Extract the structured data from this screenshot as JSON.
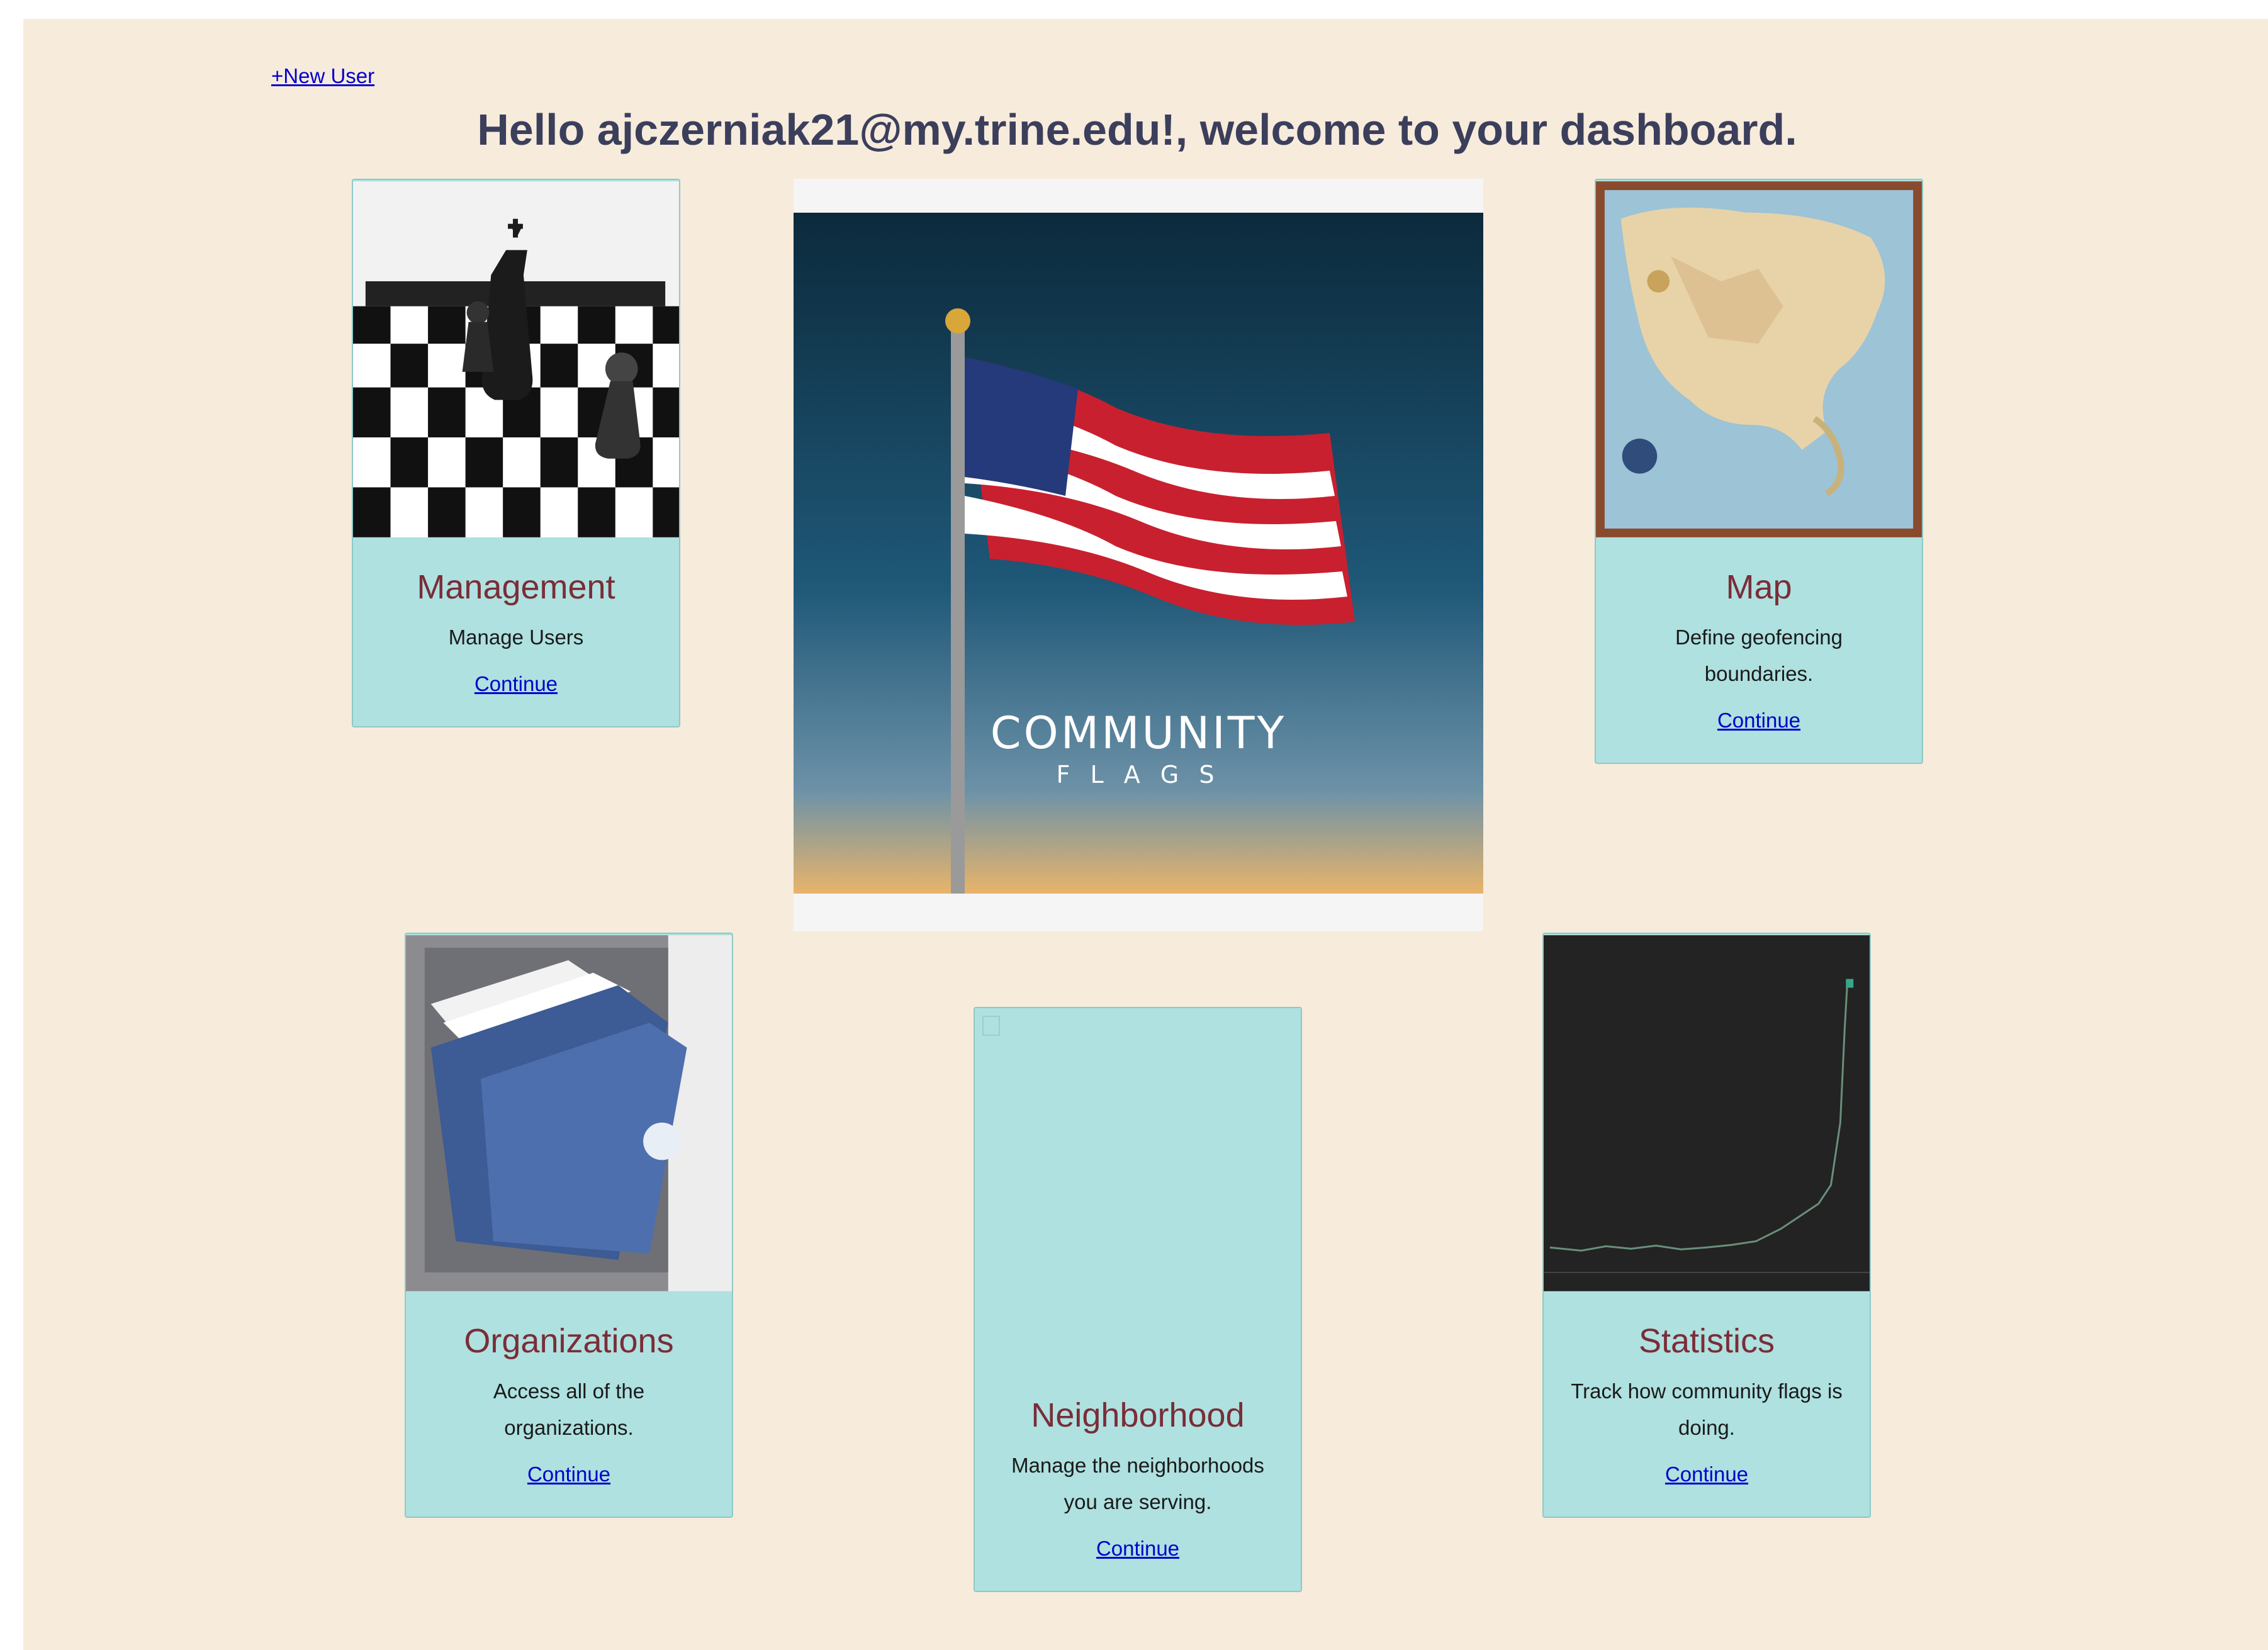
{
  "header": {
    "new_user_link": "+New User",
    "greeting": "Hello ajczerniak21@my.trine.edu!, welcome to your dashboard."
  },
  "logo": {
    "line1": "COMMUNITY",
    "line2": "F L A G S"
  },
  "cards": {
    "management": {
      "title": "Management",
      "desc": "Manage Users",
      "link": "Continue"
    },
    "map": {
      "title": "Map",
      "desc": "Define geofencing boundaries.",
      "link": "Continue"
    },
    "organizations": {
      "title": "Organizations",
      "desc": "Access all of the organizations.",
      "link": "Continue"
    },
    "neighborhood": {
      "title": "Neighborhood",
      "desc": "Manage the neighborhoods you are serving.",
      "link": "Continue"
    },
    "statistics": {
      "title": "Statistics",
      "desc": "Track how community flags is doing.",
      "link": "Continue"
    }
  },
  "colors": {
    "page_bg": "#f7ebdb",
    "card_bg": "#aee1df",
    "title_color": "#7a2d38",
    "link_color": "#0000cc",
    "greeting_color": "#3b3f5c"
  }
}
